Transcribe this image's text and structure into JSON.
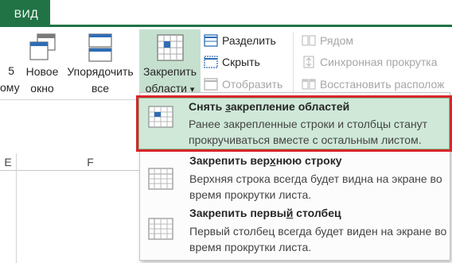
{
  "tabs": {
    "active": "ВИД"
  },
  "ribbon": {
    "cut_left": [
      "5",
      "ому"
    ],
    "new_window": [
      "Новое",
      "окно"
    ],
    "arrange_all": [
      "Упорядочить",
      "все"
    ],
    "freeze_panes": [
      "Закрепить",
      "области"
    ],
    "freeze_panes_arrow": "▾",
    "split": "Разделить",
    "hide": "Скрыть",
    "unhide": "Отобразить",
    "side_by_side": "Рядом",
    "sync_scroll": "Синхронная прокрутка",
    "reset_position": "Восстановить располож"
  },
  "sheet": {
    "col_e": "E",
    "col_f": "F"
  },
  "menu": {
    "items": [
      {
        "title_pre": "Снять ",
        "title_u": "з",
        "title_post": "акрепление областей",
        "desc": "Ранее закрепленные строки и столбцы станут прокручиваться вместе с остальным листом."
      },
      {
        "title_pre": "Закрепить вер",
        "title_u": "х",
        "title_post": "нюю строку",
        "desc": "Верхняя строка всегда будет видна на экране во время прокрутки листа."
      },
      {
        "title_pre": "Закрепить первы",
        "title_u": "й",
        "title_post": " столбец",
        "desc": "Первый столбец всегда будет виден на экране во время прокрутки листа."
      }
    ]
  },
  "colors": {
    "excel_green": "#217346",
    "highlight_border": "#d9252a",
    "highlight_fill": "#cfe8d8",
    "pressed_fill": "#c6e0cf",
    "disabled_text": "#a6a6a6",
    "icon_blue": "#2f6db5"
  }
}
